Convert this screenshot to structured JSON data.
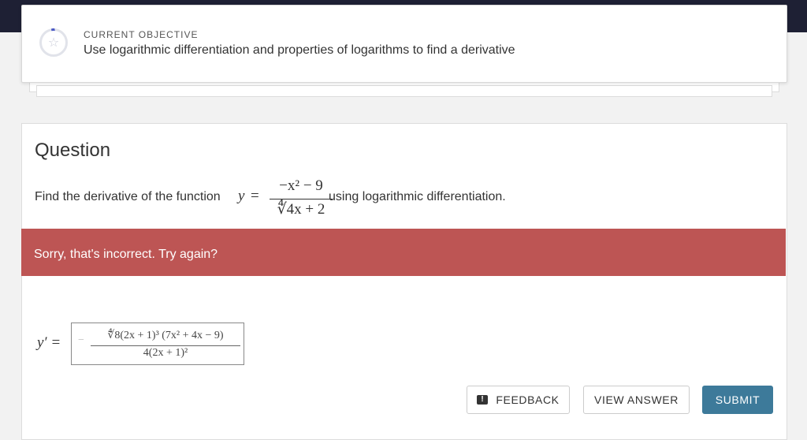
{
  "objective": {
    "label": "CURRENT OBJECTIVE",
    "text": "Use logarithmic differentiation and properties of logarithms to find a derivative",
    "icon": "star-icon"
  },
  "question": {
    "heading": "Question",
    "prompt_before": "Find the derivative of the function",
    "math": {
      "lhs": "y",
      "eq": "=",
      "numerator": "−x² − 9",
      "denominator": "∜4x + 2"
    },
    "prompt_after": "using logarithmic differentiation."
  },
  "feedback": {
    "message": "Sorry, that's incorrect. Try again?",
    "color": "#bd5554"
  },
  "answer": {
    "label": "y′ =",
    "minus": "−",
    "numerator": "∜8(2x + 1)³ (7x² + 4x − 9)",
    "denominator": "4(2x + 1)²"
  },
  "buttons": {
    "feedback": "FEEDBACK",
    "view_answer": "VIEW ANSWER",
    "submit": "SUBMIT",
    "submit_color": "#3d7a9a"
  }
}
